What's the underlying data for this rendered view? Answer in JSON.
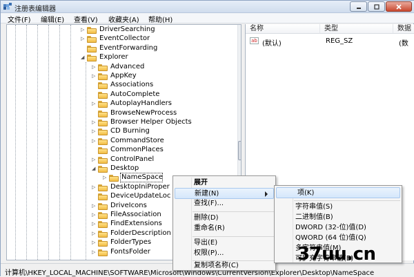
{
  "titlebar": {
    "title": "注册表编辑器",
    "minimize_icon": "minimize-icon",
    "maximize_icon": "maximize-icon",
    "close_icon": "close-icon"
  },
  "menubar": {
    "items": [
      "文件(F)",
      "编辑(E)",
      "查看(V)",
      "收藏夹(A)",
      "帮助(H)"
    ]
  },
  "tree": {
    "items": [
      {
        "label": "DriverSearching",
        "toggle": "▷"
      },
      {
        "label": "EventCollector",
        "toggle": "▷"
      },
      {
        "label": "EventForwarding",
        "toggle": ""
      },
      {
        "label": "Explorer",
        "toggle": "◢"
      },
      {
        "label": "Advanced",
        "toggle": "▷"
      },
      {
        "label": "AppKey",
        "toggle": "▷"
      },
      {
        "label": "Associations",
        "toggle": ""
      },
      {
        "label": "AutoComplete",
        "toggle": ""
      },
      {
        "label": "AutoplayHandlers",
        "toggle": "▷"
      },
      {
        "label": "BrowseNewProcess",
        "toggle": ""
      },
      {
        "label": "Browser Helper Objects",
        "toggle": "▷"
      },
      {
        "label": "CD Burning",
        "toggle": "▷"
      },
      {
        "label": "CommandStore",
        "toggle": "▷"
      },
      {
        "label": "CommonPlaces",
        "toggle": ""
      },
      {
        "label": "ControlPanel",
        "toggle": "▷"
      },
      {
        "label": "Desktop",
        "toggle": "◢"
      },
      {
        "label": "NameSpace",
        "toggle": "▷"
      },
      {
        "label": "DesktopIniProper",
        "toggle": "▷"
      },
      {
        "label": "DeviceUpdateLoc",
        "toggle": ""
      },
      {
        "label": "DriveIcons",
        "toggle": "▷"
      },
      {
        "label": "FileAssociation",
        "toggle": "▷"
      },
      {
        "label": "FindExtensions",
        "toggle": "▷"
      },
      {
        "label": "FolderDescription",
        "toggle": "▷"
      },
      {
        "label": "FolderTypes",
        "toggle": "▷"
      },
      {
        "label": "FontsFolder",
        "toggle": "▷"
      }
    ]
  },
  "values_pane": {
    "headers": [
      "名称",
      "类型",
      "数据"
    ],
    "rows": [
      {
        "name": "(默认)",
        "type": "REG_SZ",
        "data": "(数"
      }
    ],
    "string_icon": "ab"
  },
  "context_menu": {
    "items": [
      "展开",
      "新建(N)",
      "查找(F)...",
      "删除(D)",
      "重命名(R)",
      "导出(E)",
      "权限(P)...",
      "复制项名称(C)"
    ]
  },
  "submenu": {
    "items": [
      "项(K)",
      "字符串值(S)",
      "二进制值(B)",
      "DWORD (32-位)值(D)",
      "QWORD (64 位)值(Q)",
      "多字符串值(M)",
      "可扩充字符串值(E)"
    ]
  },
  "statusbar": {
    "path": "计算机\\HKEY_LOCAL_MACHINE\\SOFTWARE\\Microsoft\\Windows\\CurrentVersion\\Explorer\\Desktop\\NameSpace"
  },
  "watermark": "37uu.cn",
  "colors": {
    "selection": "#d5e7fb",
    "folder": "#f2bd44"
  }
}
